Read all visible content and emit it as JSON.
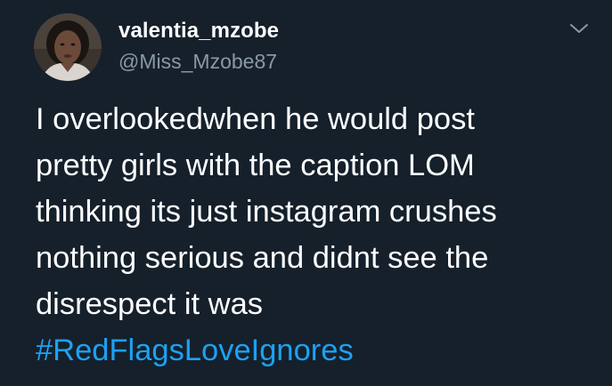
{
  "tweet": {
    "display_name": "valentia_mzobe",
    "handle": "@Miss_Mzobe87",
    "body_lines": [
      "I overlookedwhen he would post",
      "pretty girls with the caption LOM",
      "thinking its just instagram crushes",
      "nothing serious and didnt see the",
      "disrespect it was"
    ],
    "hashtag": "#RedFlagsLoveIgnores",
    "menu_icon": "chevron-down-icon",
    "avatar_icon": "profile-photo"
  },
  "colors": {
    "background": "#15202b",
    "text": "#ffffff",
    "secondary_text": "#8899a6",
    "link": "#1da1f2"
  }
}
